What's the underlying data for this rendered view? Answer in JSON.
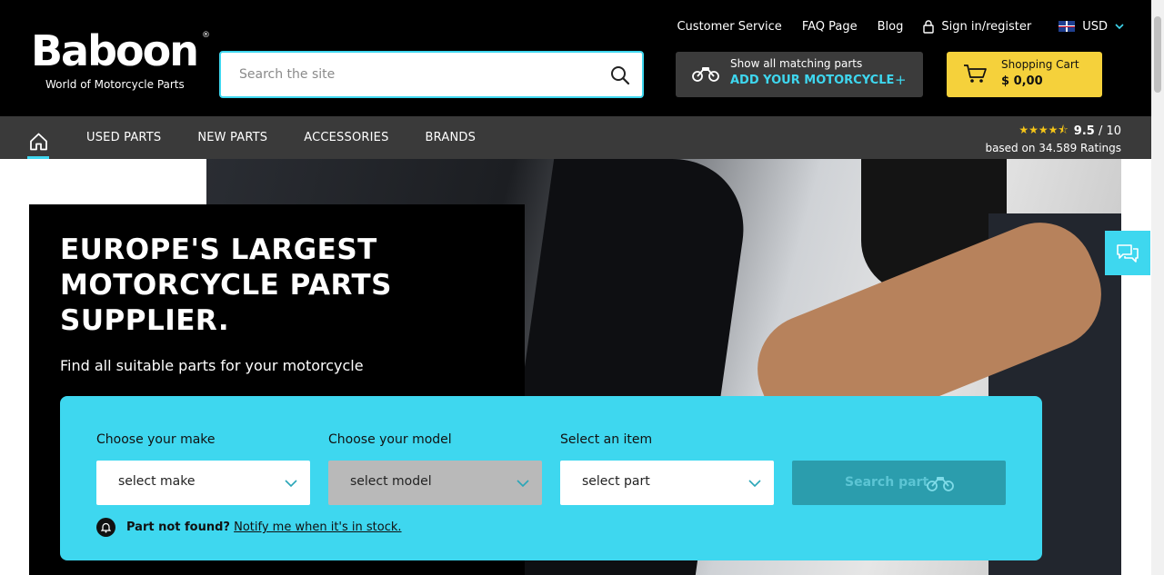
{
  "brand": {
    "name": "Baboon",
    "tagline": "World of Motorcycle Parts",
    "registered": "®"
  },
  "top_links": {
    "customer_service": "Customer Service",
    "faq": "FAQ Page",
    "blog": "Blog",
    "signin": "Sign in/register",
    "currency": "USD"
  },
  "search": {
    "placeholder": "Search the site"
  },
  "motorcycle_button": {
    "line1": "Show all matching parts",
    "line2": "ADD YOUR MOTORCYCLE",
    "plus": "+"
  },
  "cart": {
    "label": "Shopping Cart",
    "total": "$ 0,00"
  },
  "nav": {
    "items": [
      "USED PARTS",
      "NEW PARTS",
      "ACCESSORIES",
      "BRANDS"
    ]
  },
  "rating": {
    "stars": 4.5,
    "score": "9.5",
    "out_of": " / 10",
    "count_text": "based on 34.589 Ratings"
  },
  "hero": {
    "title": "EUROPE'S LARGEST MOTORCYCLE PARTS SUPPLIER.",
    "subtitle": "Find all suitable parts for your motorcycle"
  },
  "finder": {
    "make_label": "Choose your make",
    "make_value": "select make",
    "model_label": "Choose your model",
    "model_value": "select model",
    "item_label": "Select an item",
    "item_value": "select part",
    "search_label": "Search part",
    "notify_bold": "Part not found?",
    "notify_link": "Notify me when it's in stock."
  },
  "colors": {
    "accent": "#3ed7ef",
    "cart": "#f5d13b",
    "header": "#000000",
    "nav": "#3a3a3a"
  },
  "icons": {
    "search": "magnifier-icon",
    "motorcycle": "motorcycle-icon",
    "cart": "cart-icon",
    "lock": "lock-icon",
    "home": "home-icon",
    "chat": "chat-icon",
    "bell": "bell-icon"
  }
}
